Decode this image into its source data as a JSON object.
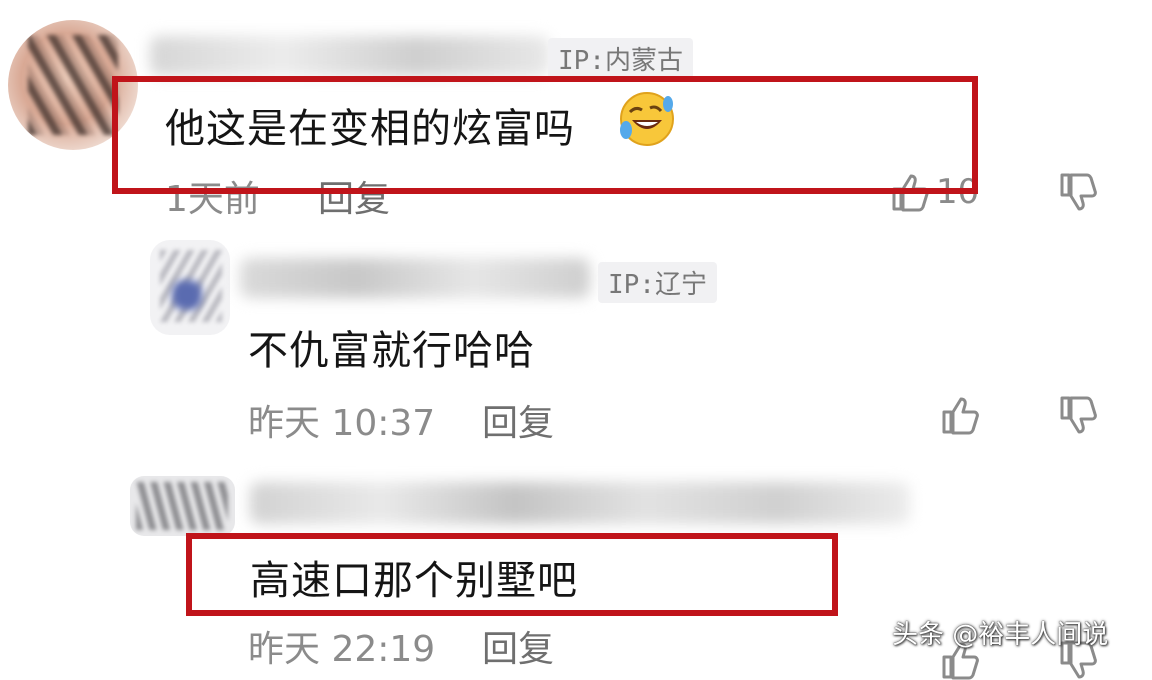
{
  "comments": [
    {
      "ip": "IP:内蒙古",
      "text": "他这是在变相的炫富吗",
      "emoji": "rolling-on-floor-laughing",
      "time": "1天前",
      "reply": "回复",
      "likes": "10"
    },
    {
      "ip": "IP:辽宁",
      "text": "不仇富就行哈哈",
      "time": "昨天 10:37",
      "reply": "回复"
    },
    {
      "text": "高速口那个别墅吧",
      "time": "昨天 22:19",
      "reply": "回复"
    }
  ],
  "watermark": "头条 @裕丰人间说",
  "colors": {
    "highlight_box": "#c0141a",
    "ip_tag_bg": "#f1f1f3",
    "meta_text": "#8b8b8b"
  }
}
